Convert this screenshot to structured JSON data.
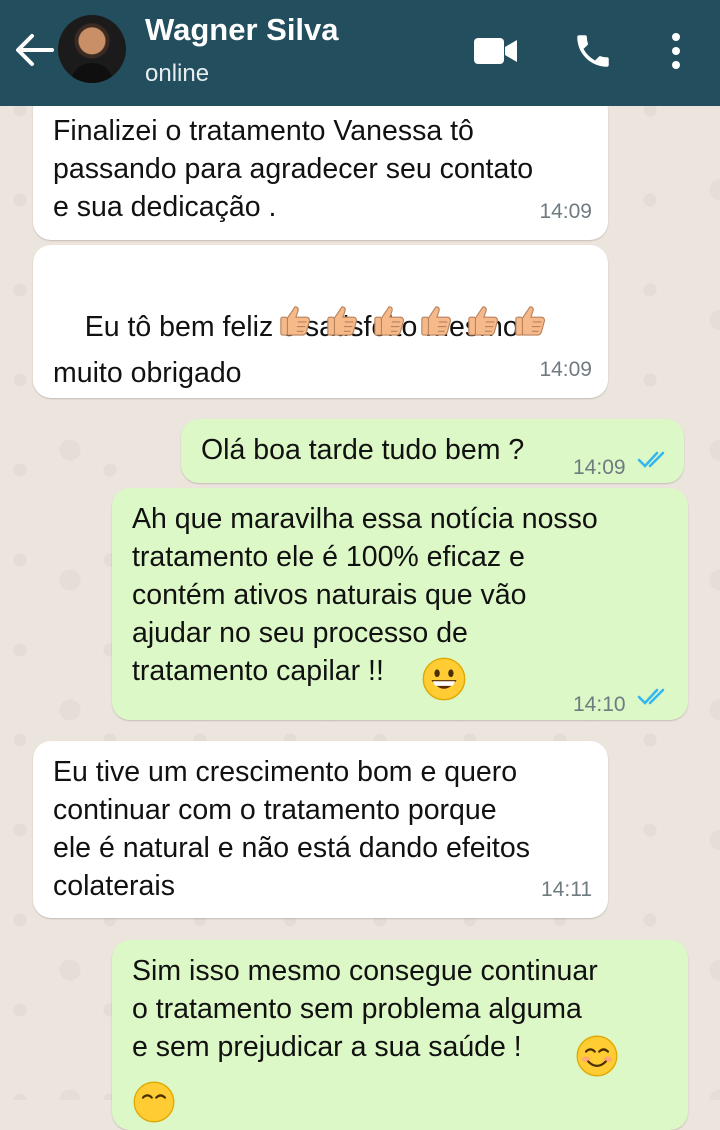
{
  "header": {
    "contact_name": "Wagner Silva",
    "status": "online",
    "color": "#234e5d"
  },
  "messages": [
    {
      "direction": "incoming",
      "text": "Finalizei o tratamento Vanessa tô\npassando para agradecer seu contato\ne sua dedicação .",
      "time": "14:09"
    },
    {
      "direction": "incoming",
      "text": "Eu tô bem feliz e satisfeito mesmo\nmuito obrigado",
      "emoji": "thumbs-up x6",
      "time": "14:09"
    },
    {
      "direction": "outgoing",
      "text": "Olá boa tarde tudo bem ?",
      "time": "14:09",
      "status": "read"
    },
    {
      "direction": "outgoing",
      "text": "Ah que maravilha essa notícia nosso\ntratamento ele é 100% eficaz e\ncontém ativos naturais que vão\najudar no seu processo de\ntratamento capilar !!",
      "emoji": "grinning-face",
      "time": "14:10",
      "status": "read"
    },
    {
      "direction": "incoming",
      "text": "Eu tive um crescimento bom e quero\ncontinuar com o tratamento porque\nele é natural e não está dando efeitos\ncolaterais",
      "time": "14:11"
    },
    {
      "direction": "outgoing",
      "text": "Sim isso mesmo consegue continuar\no tratamento sem problema alguma\ne sem prejudicar a sua saúde !",
      "emoji": "smiling-face"
    }
  ],
  "colors": {
    "incoming_bubble": "#ffffff",
    "outgoing_bubble": "#dcf8c6",
    "read_ticks": "#34b7f1",
    "chat_background": "#ece5dd"
  },
  "icons": [
    "back-arrow-icon",
    "video-call-icon",
    "phone-icon",
    "more-options-icon",
    "read-receipt-icon",
    "thumbs-up-icon",
    "grinning-face-icon",
    "smiling-face-icon"
  ]
}
